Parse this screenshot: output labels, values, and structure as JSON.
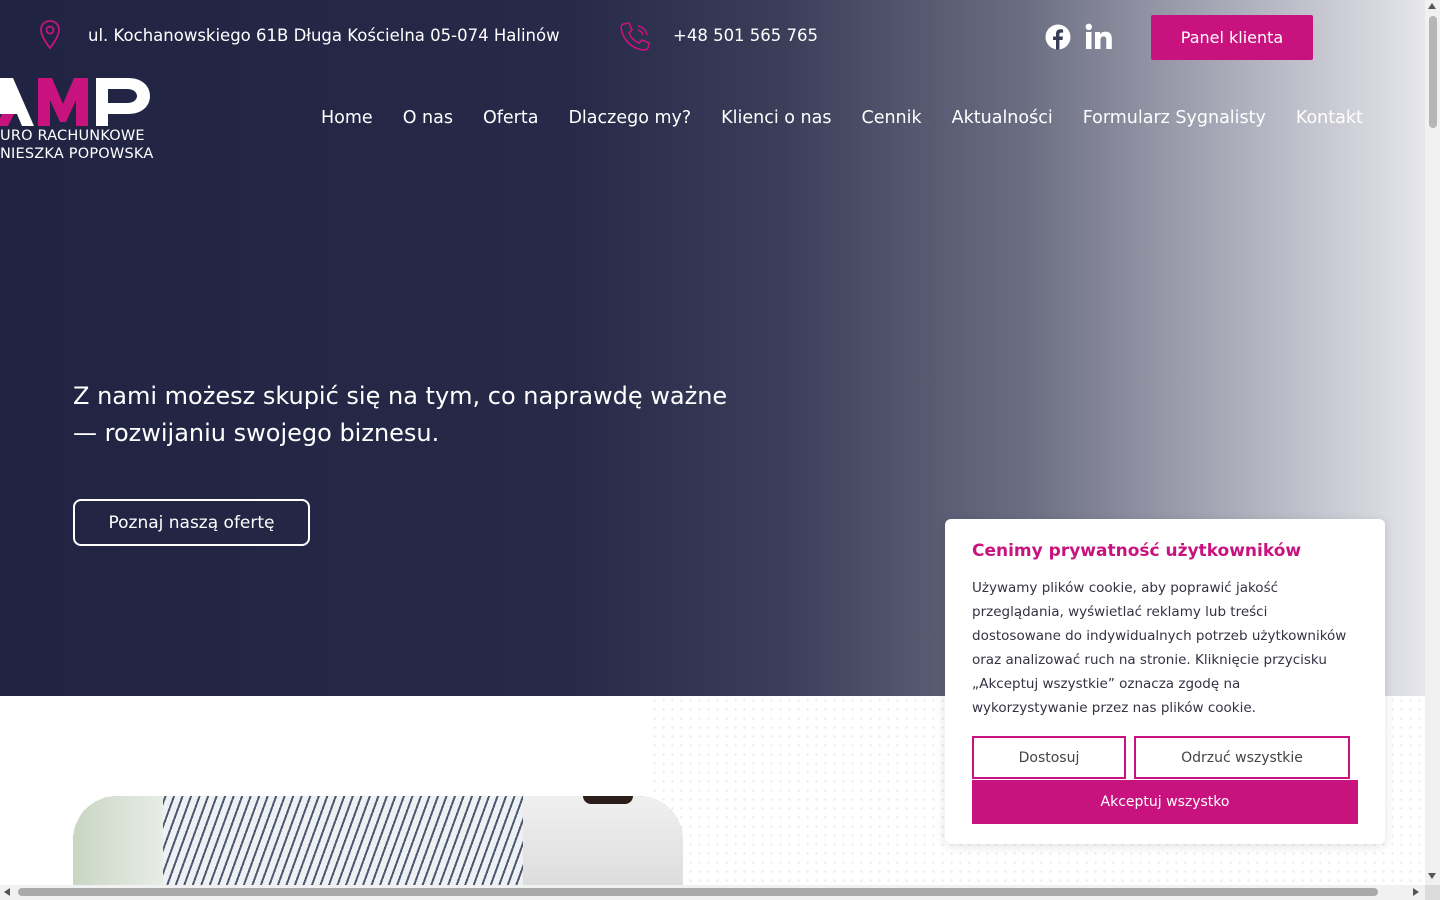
{
  "topbar": {
    "address": "ul. Kochanowskiego 61B Długa Kościelna 05-074 Halinów",
    "phone": "+48 501 565 765",
    "address_icon": "map-pin-icon",
    "phone_icon": "phone-icon",
    "social": [
      "facebook-icon",
      "linkedin-icon"
    ],
    "panel_button": "Panel klienta"
  },
  "logo": {
    "mark": "AMP",
    "line1": "URO RACHUNKOWE",
    "line2": "NIESZKA POPOWSKA"
  },
  "nav": {
    "items": [
      {
        "label": "Home"
      },
      {
        "label": "O nas"
      },
      {
        "label": "Oferta"
      },
      {
        "label": "Dlaczego my?"
      },
      {
        "label": "Klienci o nas"
      },
      {
        "label": "Cennik"
      },
      {
        "label": "Aktualności"
      },
      {
        "label": "Formularz Sygnalisty"
      },
      {
        "label": "Kontakt"
      }
    ]
  },
  "hero": {
    "headline_line1": "Z nami możesz skupić się na tym, co naprawdę ważne",
    "headline_line2": "— rozwijaniu swojego biznesu.",
    "cta": "Poznaj naszą ofertę"
  },
  "cookie": {
    "title": "Cenimy prywatność użytkowników",
    "text": "Używamy plików cookie, aby poprawić jakość przeglądania, wyświetlać reklamy lub treści dostosowane do indywidualnych potrzeb użytkowników oraz analizować ruch na stronie. Kliknięcie przycisku „Akceptuj wszystkie” oznacza zgodę na wykorzystywanie przez nas plików cookie.",
    "customize": "Dostosuj",
    "reject": "Odrzuć wszystkie",
    "accept": "Akceptuj wszystko"
  },
  "colors": {
    "accent": "#c8137f",
    "hero_dark": "#202442"
  }
}
